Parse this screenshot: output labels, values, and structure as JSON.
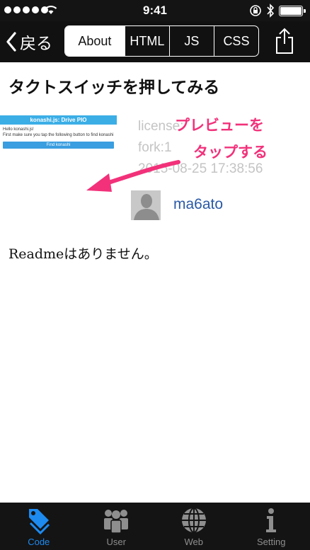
{
  "status_bar": {
    "time": "9:41"
  },
  "nav": {
    "back_label": "戻る",
    "segments": [
      "About",
      "HTML",
      "JS",
      "CSS"
    ],
    "active_segment": "About"
  },
  "page": {
    "title": "タクトスイッチを押してみる",
    "preview": {
      "header": "konashi.js: Drive PIO",
      "lines": [
        "Hello konashi.js!",
        "First make sure you tap the following button to find konashi"
      ],
      "button": "Find konashi"
    },
    "meta_lines": [
      "license:",
      "fork:1",
      "2015-08-25 17:38:56"
    ],
    "author": "ma6ato",
    "readme": "Readmeはありません。"
  },
  "annotation": {
    "line1": "プレビューを",
    "line2": "タップする",
    "color": "#f2317a"
  },
  "tabs": [
    {
      "label": "Code",
      "icon": "tag-icon",
      "active": true
    },
    {
      "label": "User",
      "icon": "users-icon",
      "active": false
    },
    {
      "label": "Web",
      "icon": "globe-icon",
      "active": false
    },
    {
      "label": "Setting",
      "icon": "info-icon",
      "active": false
    }
  ]
}
